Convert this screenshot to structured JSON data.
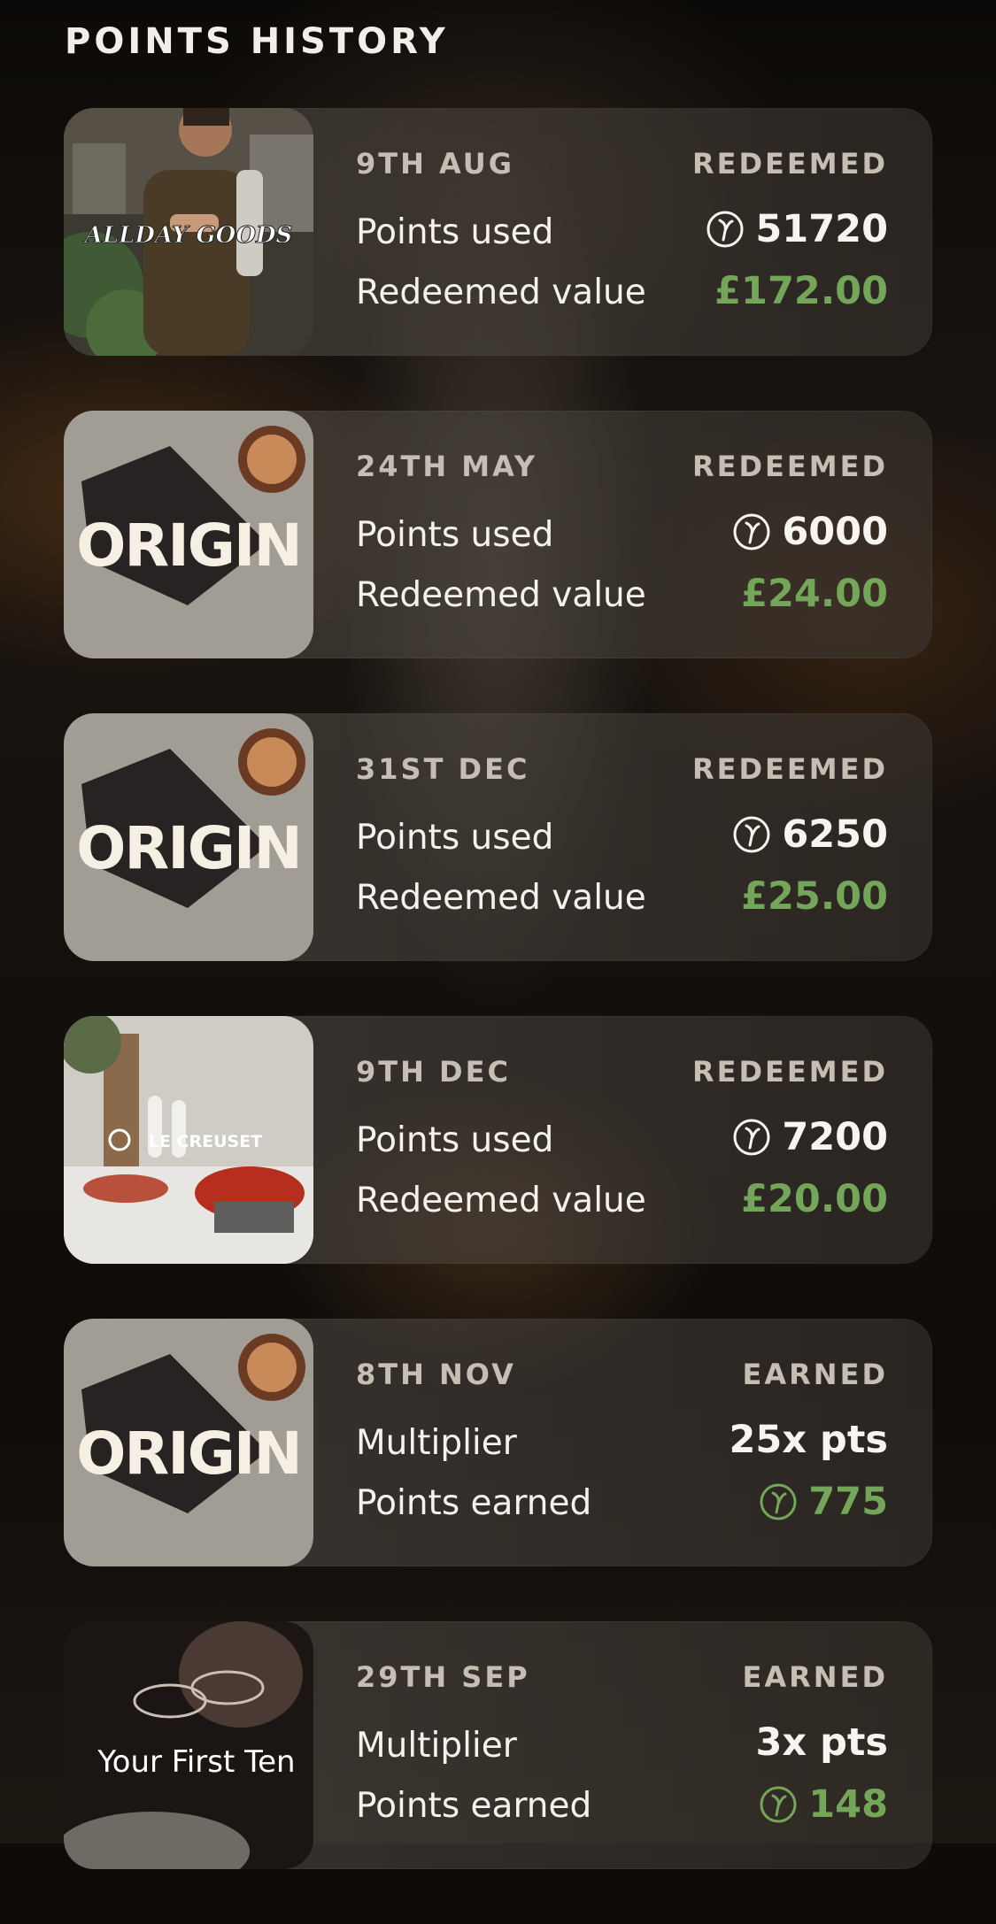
{
  "title": "POINTS HISTORY",
  "colors": {
    "accent_green": "#74a65a",
    "background": "#0e0b09"
  },
  "entries": [
    {
      "date": "9TH AUG",
      "status": "REDEEMED",
      "brand": "ALLDAY GOODS",
      "thumb_icon": "allday-goods-logo",
      "label1": "Points used",
      "value1": "51720",
      "label2": "Redeemed value",
      "value2": "£172.00"
    },
    {
      "date": "24TH MAY",
      "status": "REDEEMED",
      "brand": "ORIGIN",
      "thumb_icon": "origin-logo",
      "label1": "Points used",
      "value1": "6000",
      "label2": "Redeemed value",
      "value2": "£24.00"
    },
    {
      "date": "31ST DEC",
      "status": "REDEEMED",
      "brand": "ORIGIN",
      "thumb_icon": "origin-logo",
      "label1": "Points used",
      "value1": "6250",
      "label2": "Redeemed value",
      "value2": "£25.00"
    },
    {
      "date": "9TH DEC",
      "status": "REDEEMED",
      "brand": "LE CREUSET",
      "thumb_icon": "le-creuset-logo",
      "label1": "Points used",
      "value1": "7200",
      "label2": "Redeemed value",
      "value2": "£20.00"
    },
    {
      "date": "8TH NOV",
      "status": "EARNED",
      "brand": "ORIGIN",
      "thumb_icon": "origin-logo",
      "label1": "Multiplier",
      "value1": "25x pts",
      "label2": "Points earned",
      "value2": "775"
    },
    {
      "date": "29TH SEP",
      "status": "EARNED",
      "brand": "Your First Ten",
      "thumb_icon": "your-first-ten-logo",
      "label1": "Multiplier",
      "value1": "3x pts",
      "label2": "Points earned",
      "value2": "148"
    }
  ]
}
